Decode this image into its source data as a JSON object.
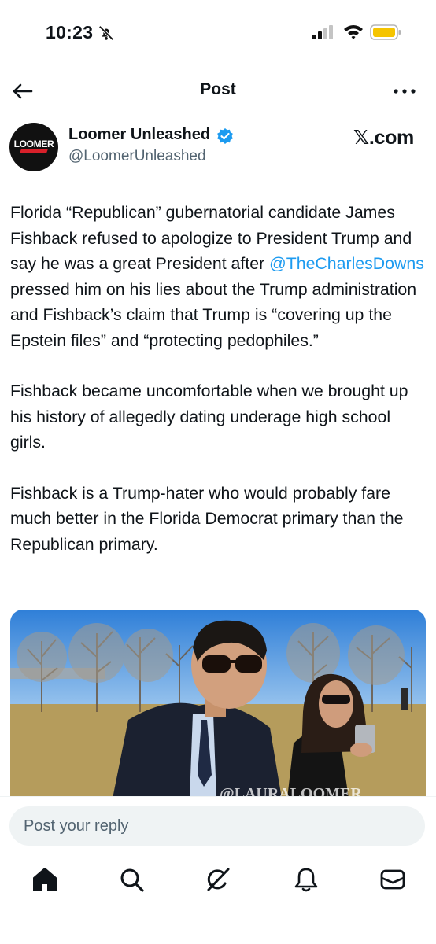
{
  "status_bar": {
    "time": "10:23"
  },
  "header": {
    "title": "Post"
  },
  "author": {
    "display_name": "Loomer Unleashed",
    "handle": "@LoomerUnleashed",
    "avatar_text": "LOOMER",
    "brand": "𝕏.com"
  },
  "post": {
    "p1_before": "Florida “Republican” gubernatorial candidate James Fishback refused to apologize to President Trump and say he was a great President after ",
    "p1_mention": "@TheCharlesDowns",
    "p1_after": " pressed him on his lies about the Trump administration and Fishback’s claim that Trump is “covering up the Epstein files” and “protecting pedophiles.”",
    "p2": "Fishback became uncomfortable when we brought up his history of allegedly dating underage high school girls.",
    "p3": "Fishback is a Trump-hater who would probably fare much better in the Florida Democrat primary than the Republican primary.",
    "media_watermark": "@LAURALOOMER"
  },
  "reply": {
    "placeholder": "Post your reply"
  },
  "nav": [
    "home-icon",
    "search-icon",
    "grok-icon",
    "notifications-icon",
    "messages-icon"
  ],
  "colors": {
    "accent": "#1d9bf0",
    "text": "#0f1419",
    "muted": "#536471"
  }
}
